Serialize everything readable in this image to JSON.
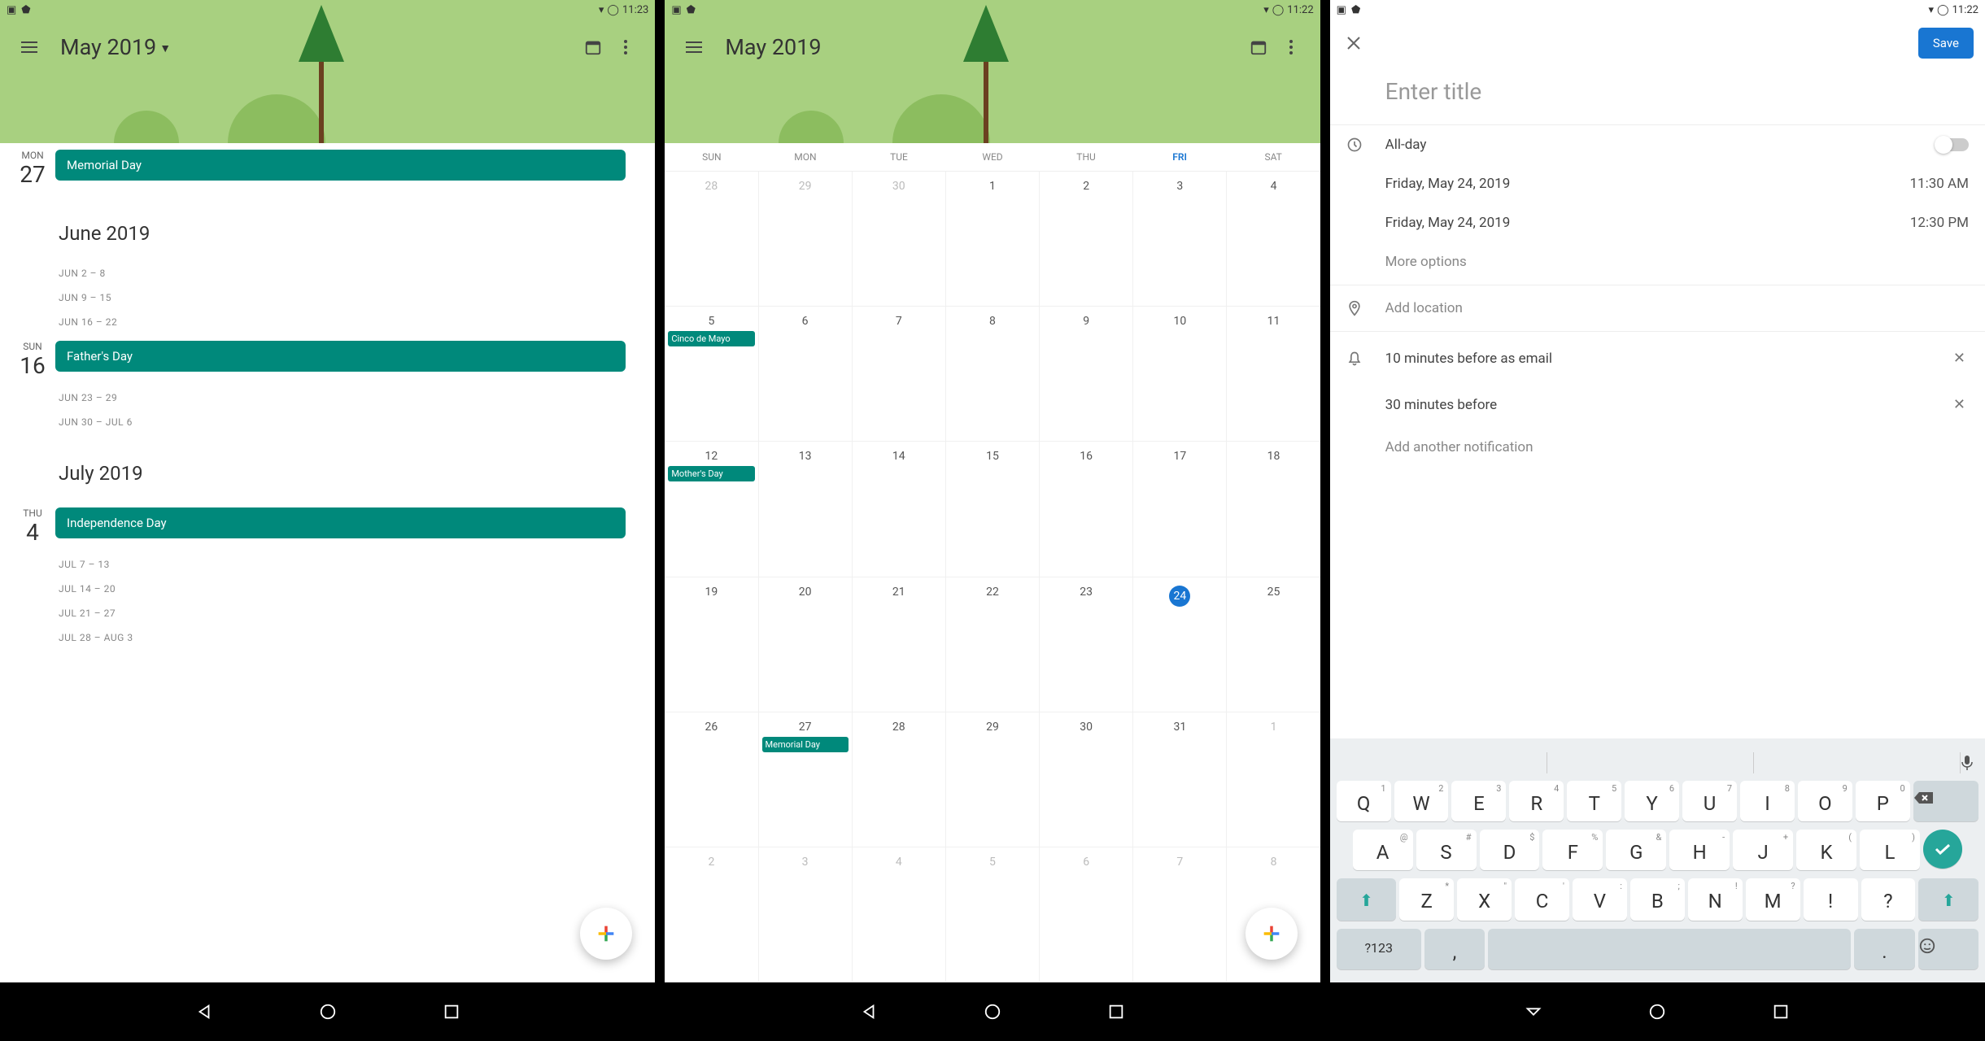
{
  "status": {
    "time1": "11:23",
    "time2": "11:22",
    "time3": "11:22"
  },
  "phone1": {
    "title": "May 2019",
    "today_icon": "📅",
    "days": [
      {
        "dow": "MON",
        "num": "27",
        "event": "Memorial Day"
      }
    ],
    "months": [
      {
        "name": "June 2019",
        "weeks": [
          "JUN 2 – 8",
          "JUN 9 – 15",
          "JUN 16 – 22"
        ],
        "day": {
          "dow": "SUN",
          "num": "16",
          "event": "Father's Day"
        },
        "weeks2": [
          "JUN 23 – 29",
          "JUN 30 – JUL 6"
        ]
      },
      {
        "name": "July 2019",
        "day": {
          "dow": "THU",
          "num": "4",
          "event": "Independence Day"
        },
        "weeks": [
          "JUL 7 – 13",
          "JUL 14 – 20",
          "JUL 21 – 27",
          "JUL 28 – AUG 3"
        ]
      }
    ]
  },
  "phone2": {
    "title": "May 2019",
    "dow": [
      "SUN",
      "MON",
      "TUE",
      "WED",
      "THU",
      "FRI",
      "SAT"
    ],
    "today_index": 5,
    "weeks": [
      {
        "days": [
          "28",
          "29",
          "30",
          "1",
          "2",
          "3",
          "4"
        ],
        "muted": [
          0,
          1,
          2
        ],
        "events": {}
      },
      {
        "days": [
          "5",
          "6",
          "7",
          "8",
          "9",
          "10",
          "11"
        ],
        "muted": [],
        "events": {
          "0": "Cinco de Mayo"
        }
      },
      {
        "days": [
          "12",
          "13",
          "14",
          "15",
          "16",
          "17",
          "18"
        ],
        "muted": [],
        "events": {
          "0": "Mother's Day"
        }
      },
      {
        "days": [
          "19",
          "20",
          "21",
          "22",
          "23",
          "24",
          "25"
        ],
        "muted": [],
        "today": 5,
        "events": {}
      },
      {
        "days": [
          "26",
          "27",
          "28",
          "29",
          "30",
          "31",
          "1"
        ],
        "muted": [
          6
        ],
        "events": {
          "1": "Memorial Day"
        }
      },
      {
        "days": [
          "2",
          "3",
          "4",
          "5",
          "6",
          "7",
          "8"
        ],
        "muted": [
          0,
          1,
          2,
          3,
          4,
          5,
          6
        ],
        "events": {}
      }
    ]
  },
  "phone3": {
    "save": "Save",
    "title_placeholder": "Enter title",
    "allday_label": "All-day",
    "start_date": "Friday, May 24, 2019",
    "start_time": "11:30 AM",
    "end_date": "Friday, May 24, 2019",
    "end_time": "12:30 PM",
    "more_options": "More options",
    "add_location": "Add location",
    "notif1": "10 minutes before as email",
    "notif2": "30 minutes before",
    "add_notif": "Add another notification",
    "keyboard": {
      "row1": [
        [
          "Q",
          "1"
        ],
        [
          "W",
          "2"
        ],
        [
          "E",
          "3"
        ],
        [
          "R",
          "4"
        ],
        [
          "T",
          "5"
        ],
        [
          "Y",
          "6"
        ],
        [
          "U",
          "7"
        ],
        [
          "I",
          "8"
        ],
        [
          "O",
          "9"
        ],
        [
          "P",
          "0"
        ]
      ],
      "row2": [
        [
          "A",
          "@"
        ],
        [
          "S",
          "#"
        ],
        [
          "D",
          "$"
        ],
        [
          "F",
          "%"
        ],
        [
          "G",
          "&"
        ],
        [
          "H",
          "-"
        ],
        [
          "J",
          "+"
        ],
        [
          "K",
          "("
        ],
        [
          "L",
          ")"
        ]
      ],
      "row3": [
        [
          "Z",
          "*"
        ],
        [
          "X",
          "\""
        ],
        [
          "C",
          "'"
        ],
        [
          "V",
          ":"
        ],
        [
          "B",
          ";"
        ],
        [
          "N",
          "!"
        ],
        [
          "M",
          "?"
        ],
        [
          "!",
          ""
        ],
        [
          "?",
          ""
        ]
      ],
      "sym": "?123",
      "comma": ",",
      "period": "."
    }
  }
}
